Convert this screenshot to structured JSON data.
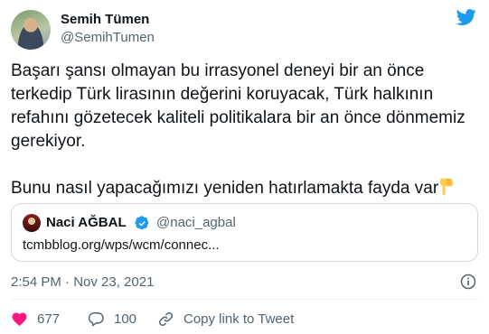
{
  "author": {
    "name": "Semih Tümen",
    "handle": "@SemihTumen"
  },
  "tweet": {
    "paragraph1": "Başarı şansı olmayan bu irrasyonel deneyi bir an önce terkedip Türk lirasının değerini koruyacak, Türk halkının refahını gözetecek kaliteli politikalara bir an önce dönmemiz gerekiyor.",
    "paragraph2": "Bunu nasıl yapacağımızı yeniden hatırlamakta fayda var"
  },
  "quoted": {
    "name": "Naci AĞBAL",
    "handle": "@naci_agbal",
    "link": "tcmbblog.org/wps/wcm/connec..."
  },
  "timestamp": "2:54 PM · Nov 23, 2021",
  "actions": {
    "likes": "677",
    "replies": "100",
    "copy_label": "Copy link to Tweet"
  },
  "colors": {
    "text": "#0f1419",
    "muted": "#536471",
    "brand": "#1d9bf0",
    "like": "#f91880",
    "border": "#cfd9de"
  }
}
